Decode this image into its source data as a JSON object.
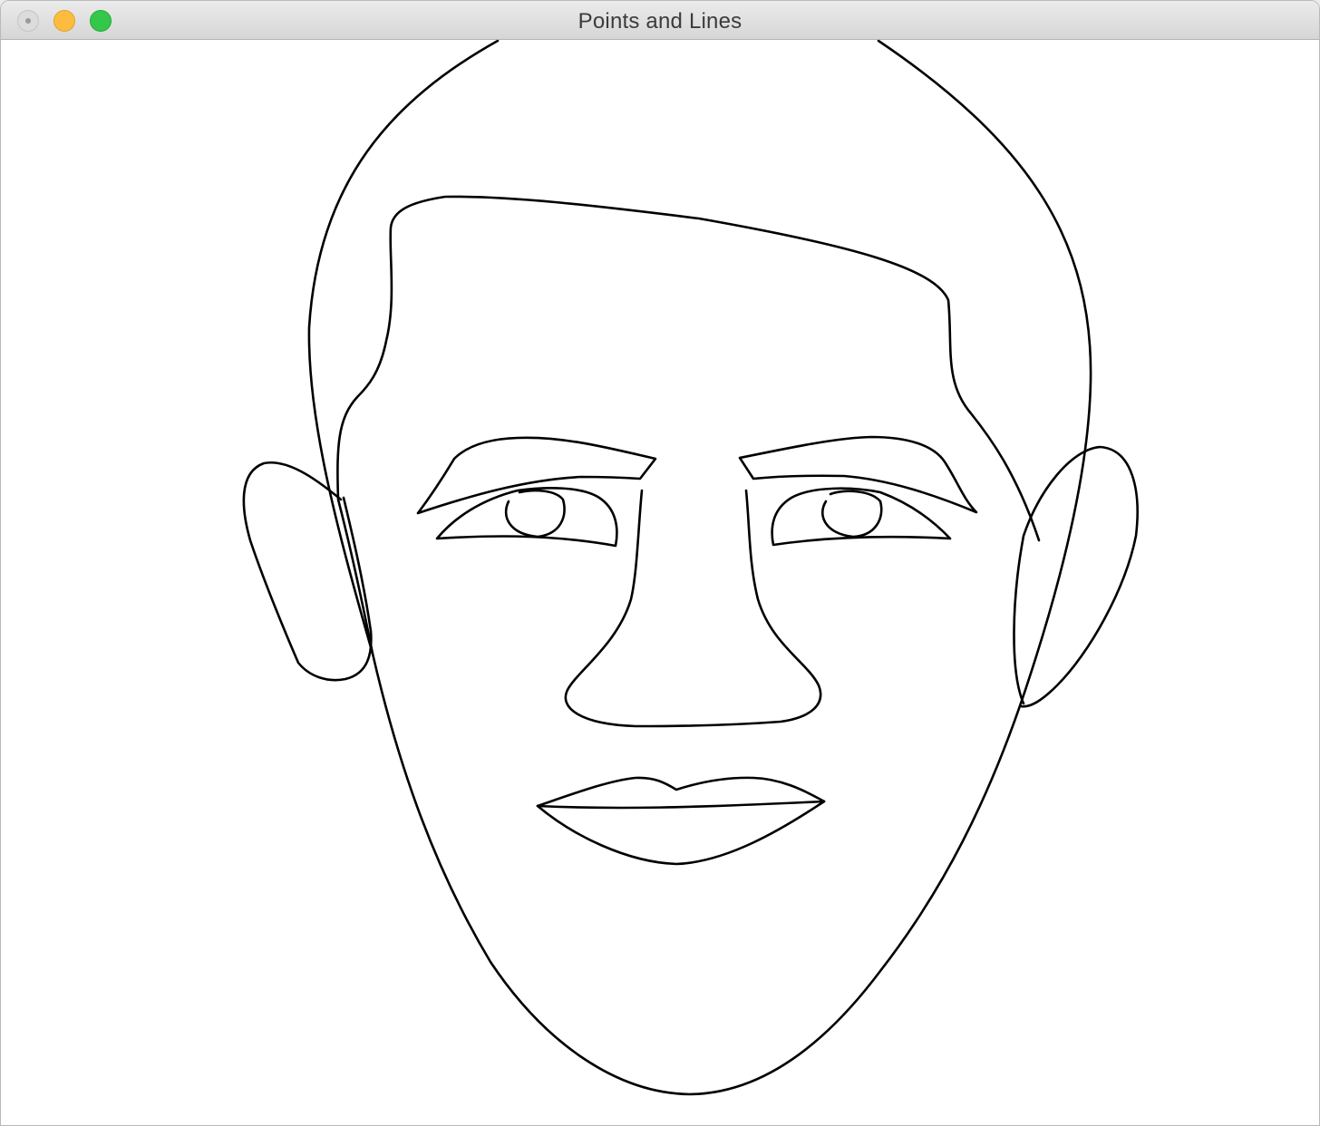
{
  "window": {
    "title": "Points and Lines"
  },
  "titlebar": {
    "buttons": [
      {
        "name": "close",
        "color": "#dcdcdc"
      },
      {
        "name": "minimize",
        "color": "#fdbc40"
      },
      {
        "name": "maximize",
        "color": "#34c84a"
      }
    ]
  },
  "canvas": {
    "background": "#ffffff",
    "stroke_color": "#000000"
  }
}
